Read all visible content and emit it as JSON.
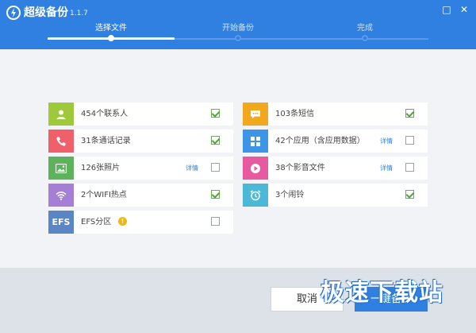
{
  "app": {
    "title": "超级备份",
    "version": "1.1.7"
  },
  "window": {
    "menu_glyph": "□",
    "close_glyph": "✕"
  },
  "steps": [
    {
      "label": "选择文件",
      "active": true
    },
    {
      "label": "开始备份",
      "active": false
    },
    {
      "label": "完成",
      "active": false
    }
  ],
  "items_left": [
    {
      "label": "454个联系人",
      "icon": "contact-icon",
      "color": "#9dc93b",
      "detail": "",
      "checked": true
    },
    {
      "label": "31条通话记录",
      "icon": "phone-icon",
      "color": "#f0606a",
      "detail": "",
      "checked": true
    },
    {
      "label": "126张照片",
      "icon": "photo-icon",
      "color": "#5cb35c",
      "detail": "详情",
      "checked": false
    },
    {
      "label": "2个WIFI热点",
      "icon": "wifi-icon",
      "color": "#a57fd6",
      "detail": "",
      "checked": true
    },
    {
      "label": "EFS分区",
      "icon": "efs-icon",
      "color": "#5b86c6",
      "icon_text": "EFS",
      "detail": "",
      "checked": false,
      "warn": "!"
    }
  ],
  "items_right": [
    {
      "label": "103条短信",
      "icon": "sms-icon",
      "color": "#f2a81d",
      "detail": "",
      "checked": true
    },
    {
      "label": "42个应用（含应用数据）",
      "icon": "apps-icon",
      "color": "#3c95e6",
      "detail": "详情",
      "checked": false
    },
    {
      "label": "38个影音文件",
      "icon": "media-icon",
      "color": "#e85a9f",
      "detail": "详情",
      "checked": false
    },
    {
      "label": "3个闹铃",
      "icon": "alarm-icon",
      "color": "#4ab8d6",
      "detail": "",
      "checked": true
    }
  ],
  "buttons": {
    "cancel": "取消",
    "backup": "一键备份"
  },
  "watermark": "极速下载站",
  "colors": {
    "primary": "#2f80e0",
    "check": "#4fa33a"
  }
}
